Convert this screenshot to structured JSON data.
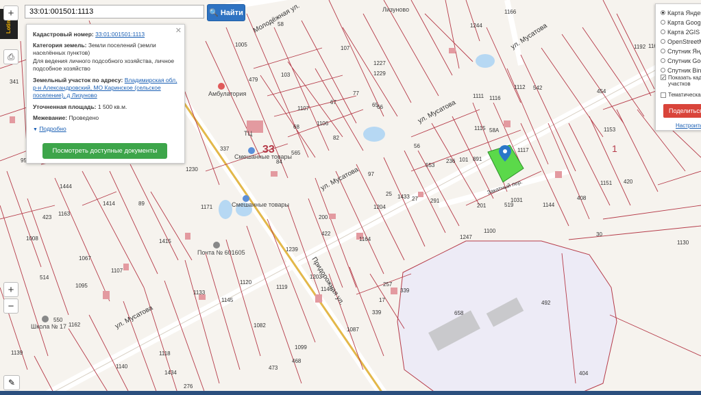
{
  "search": {
    "value": "33:01:001501:1113",
    "button_label": "Найти"
  },
  "brand": {
    "label": "Lotinfo"
  },
  "toolbar": {
    "zoom_in": "+",
    "zoom_out": "−",
    "print": "⎙",
    "ruler": "✎"
  },
  "info": {
    "cad_label": "Кадастровый номер:",
    "cad_value": "33:01:001501:1113",
    "cat_label": "Категория земель:",
    "cat_value": "Земли поселений (земли населённых пунктов)",
    "use_value": "Для ведения личного подсобного хозяйства, личное подсобное хозяйство",
    "addr_label": "Земельный участок по адресу:",
    "addr_value": "Владимирская обл, р-н Александровский, МО Каринское (сельское поселение), д Лизуново",
    "area_label": "Уточненная площадь:",
    "area_value": "1 500 кв.м.",
    "survey_label": "Межевание:",
    "survey_value": "Проведено",
    "more_link": "Подробно",
    "docs_button": "Посмотреть доступные документы"
  },
  "layers": {
    "items": [
      "Карта Яндекс",
      "Карта Google",
      "Карта 2GIS",
      "OpenStreetMap",
      "Спутник Яндекс",
      "Спутник Google",
      "Спутник Bing"
    ],
    "selected": 0,
    "checks": [
      {
        "label": "Показать кадастровые границы участков",
        "checked": true
      },
      {
        "label": "Тематическая",
        "checked": false
      }
    ],
    "share_button": "Поделиться",
    "settings_link": "Настроить"
  },
  "map": {
    "streets": {
      "musatova_top": "ул. Мусатова",
      "musatova_mid": "ул. Мусатова",
      "musatova_bottom": "ул. Мусатова",
      "molodezhnaya": "Молодёжная ул.",
      "pridorozhnaya": "Придорожная ул.",
      "zakatny": "Закатный пер."
    },
    "places": {
      "village": "Лизуново",
      "clinic": "Амбулатория",
      "post": "Почта № 601605",
      "school": "Школа № 17",
      "shop1": "Смешанные товары",
      "shop2": "Смешанные товары",
      "tc": "ТЦ"
    },
    "big_numbers": {
      "quarter": "33",
      "one": "1"
    },
    "parcel_labels": [
      "341",
      "1005",
      "103",
      "107",
      "1227",
      "1229",
      "1244",
      "1166",
      "1192",
      "1160",
      "1157",
      "1162",
      "1155",
      "1111",
      "1112",
      "1116",
      "1115",
      "1117",
      "1153",
      "1151",
      "542",
      "454",
      "479",
      "58",
      "67",
      "77",
      "65",
      "66",
      "82",
      "68",
      "1107",
      "1106",
      "84",
      "565",
      "553",
      "236",
      "101",
      "891",
      "1031",
      "1144",
      "408",
      "420",
      "95",
      "1444",
      "1163",
      "1414",
      "1171",
      "89",
      "1415",
      "337",
      "1230",
      "423",
      "1008",
      "514",
      "1095",
      "1107",
      "1162",
      "1133",
      "1120",
      "1145",
      "1119",
      "17",
      "422",
      "1164",
      "1204",
      "25",
      "27",
      "291",
      "201",
      "519",
      "1100",
      "1247",
      "1130",
      "492",
      "658",
      "339",
      "339",
      "257",
      "1203",
      "1146",
      "1082",
      "1099",
      "1434",
      "1118",
      "1139",
      "1140",
      "473",
      "468",
      "276",
      "1087",
      "550",
      "1067",
      "1239",
      "1433",
      "97",
      "200",
      "56",
      "58A",
      "30",
      "404",
      "1129",
      "1043",
      "659"
    ],
    "colors": {
      "boundary": "#b53a48",
      "selected_fill": "#5bd94a",
      "marker": "#2a78c8",
      "industrial": "#ecebf4"
    }
  }
}
